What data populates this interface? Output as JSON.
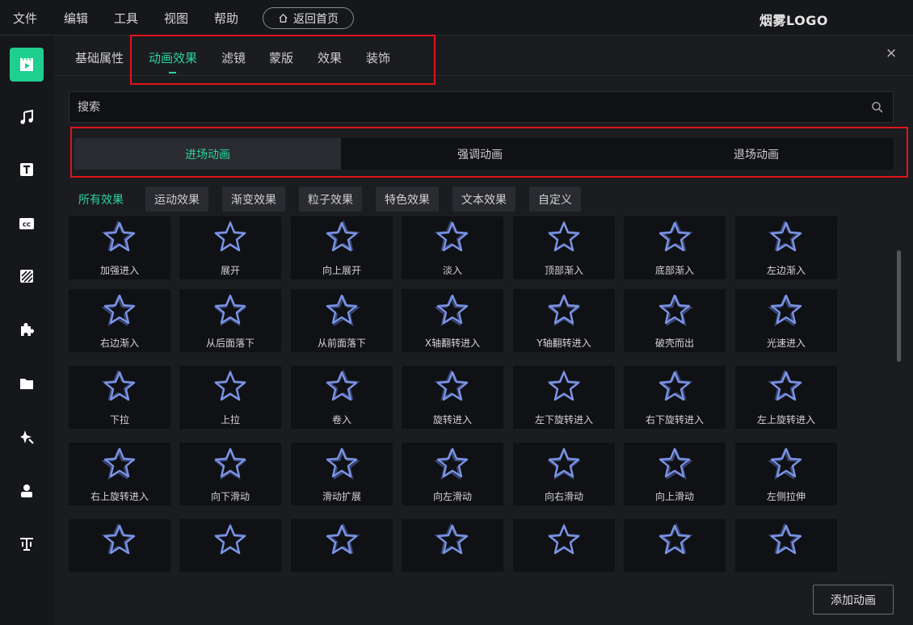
{
  "menu": {
    "items": [
      "文件",
      "编辑",
      "工具",
      "视图",
      "帮助"
    ],
    "home_label": "返回首页",
    "logo": "烟雾LOGO"
  },
  "sidebar": {
    "icons": [
      "clapperboard-icon",
      "music-icon",
      "text-icon",
      "caption-icon",
      "filter-icon",
      "puzzle-icon",
      "folder-icon",
      "sparkle-icon",
      "avatar-icon",
      "text-style-icon"
    ],
    "active_index": 0
  },
  "tabs": {
    "items": [
      "基础属性",
      "动画效果",
      "滤镜",
      "蒙版",
      "效果",
      "装饰"
    ],
    "active_index": 1,
    "close": "×"
  },
  "search": {
    "placeholder": "搜索"
  },
  "segments": {
    "items": [
      "进场动画",
      "强调动画",
      "退场动画"
    ],
    "active_index": 0
  },
  "filters": {
    "items": [
      "所有效果",
      "运动效果",
      "渐变效果",
      "粒子效果",
      "特色效果",
      "文本效果",
      "自定义"
    ],
    "active_index": 0
  },
  "animations": [
    "加强进入",
    "展开",
    "向上展开",
    "淡入",
    "顶部渐入",
    "底部渐入",
    "左边渐入",
    "右边渐入",
    "从后面落下",
    "从前面落下",
    "X轴翻转进入",
    "Y轴翻转进入",
    "破壳而出",
    "光速进入",
    "下拉",
    "上拉",
    "卷入",
    "旋转进入",
    "左下旋转进入",
    "右下旋转进入",
    "左上旋转进入",
    "右上旋转进入",
    "向下滑动",
    "滑动扩展",
    "向左滑动",
    "向右滑动",
    "向上滑动",
    "左侧拉伸",
    "",
    "",
    "",
    "",
    "",
    "",
    ""
  ],
  "footer": {
    "add_label": "添加动画"
  },
  "colors": {
    "accent": "#2ad49a",
    "highlight": "#e0141d",
    "star": "#7b94e6"
  }
}
